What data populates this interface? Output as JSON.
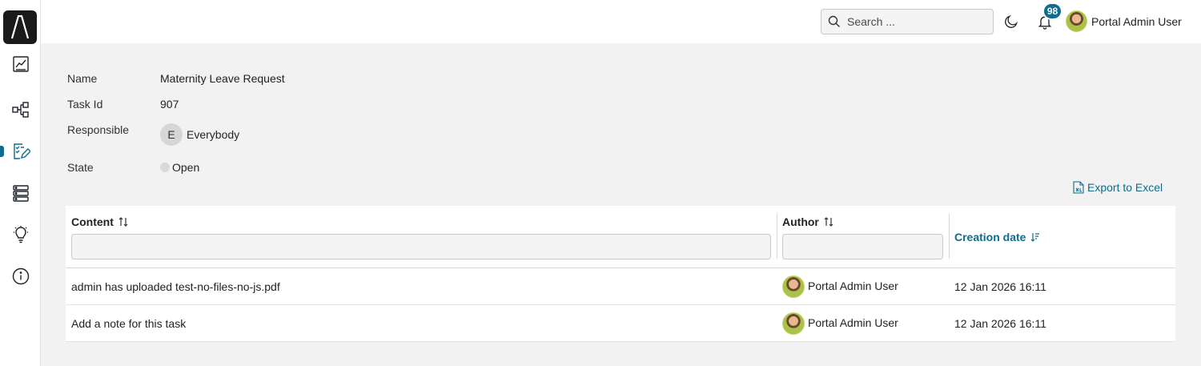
{
  "topbar": {
    "search_placeholder": "Search ...",
    "notification_count": "98",
    "user_name": "Portal Admin User"
  },
  "sidebar": {
    "items": [
      {
        "name": "dashboard",
        "icon": "chart-icon"
      },
      {
        "name": "processes",
        "icon": "process-icon"
      },
      {
        "name": "tasks",
        "icon": "task-edit-icon",
        "active": true
      },
      {
        "name": "cases",
        "icon": "list-icon"
      },
      {
        "name": "statistics",
        "icon": "lightbulb-icon"
      },
      {
        "name": "about",
        "icon": "info-icon"
      }
    ]
  },
  "details": {
    "name_label": "Name",
    "name_value": "Maternity Leave Request",
    "taskid_label": "Task Id",
    "taskid_value": "907",
    "responsible_label": "Responsible",
    "responsible_initial": "E",
    "responsible_value": "Everybody",
    "state_label": "State",
    "state_value": "Open"
  },
  "export_label": "Export to Excel",
  "table": {
    "columns": {
      "content": "Content",
      "author": "Author",
      "creation_date": "Creation date"
    },
    "rows": [
      {
        "content": "admin has uploaded test-no-files-no-js.pdf",
        "author": "Portal Admin User",
        "date": "12 Jan 2026 16:11"
      },
      {
        "content": "Add a note for this task",
        "author": "Portal Admin User",
        "date": "12 Jan 2026 16:11"
      }
    ]
  },
  "colors": {
    "accent": "#0f6c8e",
    "background": "#f2f2f2"
  }
}
